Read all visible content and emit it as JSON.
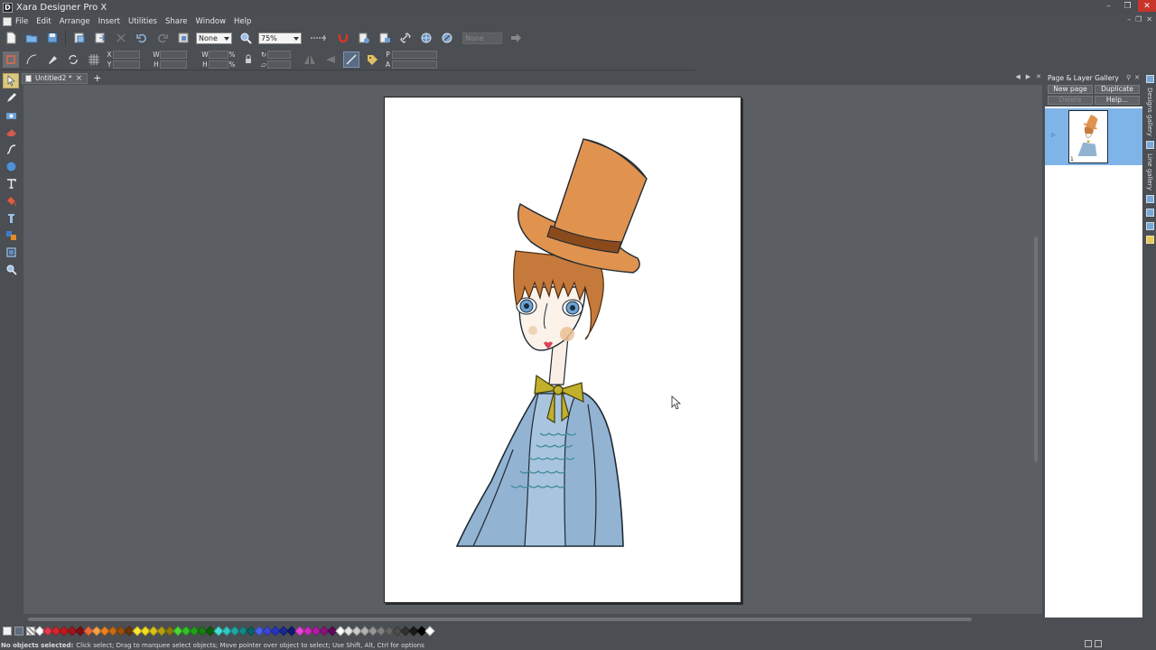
{
  "window": {
    "title": "Xara Designer Pro X",
    "app_icon_letter": "D",
    "controls": [
      "minimize",
      "maximize",
      "close"
    ]
  },
  "menu": {
    "items": [
      "File",
      "Edit",
      "Arrange",
      "Insert",
      "Utilities",
      "Share",
      "Window",
      "Help"
    ]
  },
  "toolbar1": {
    "quality_value": "None",
    "zoom_value": "75%",
    "disabled_combo_value": "None"
  },
  "toolbar2": {
    "labels": {
      "x": "X",
      "y": "Y",
      "w": "W",
      "h": "H",
      "w2": "W",
      "h2": "H",
      "p": "P",
      "a": "A",
      "pct1": "%",
      "pct2": "%"
    }
  },
  "document": {
    "tab_label": "Untitled2 *",
    "add_tab_symbol": "+"
  },
  "gallery": {
    "title": "Page & Layer Gallery",
    "buttons": [
      {
        "label": "New page",
        "enabled": true
      },
      {
        "label": "Duplicate",
        "enabled": true
      },
      {
        "label": "Delete",
        "enabled": false
      },
      {
        "label": "Help...",
        "enabled": true
      }
    ],
    "pages": [
      {
        "number": "1",
        "selected": true
      }
    ]
  },
  "side_tabs": [
    "Designs gallery",
    "Line gallery"
  ],
  "palette": {
    "colors": [
      "#ffffff",
      "#e4394e",
      "#d8262b",
      "#c2181c",
      "#a5141b",
      "#7d0f12",
      "#f06a3b",
      "#f7a24b",
      "#ea8222",
      "#c96b10",
      "#9c4f0d",
      "#6e3609",
      "#fbe83c",
      "#f5dd21",
      "#d9c11a",
      "#b6a112",
      "#8f7e0b",
      "#4bdb38",
      "#33c226",
      "#21a318",
      "#168212",
      "#0d5e0b",
      "#46e0d8",
      "#30c8c3",
      "#20a8a6",
      "#15888a",
      "#0c6266",
      "#4a62f0",
      "#3748d8",
      "#2536bd",
      "#1a2799",
      "#0f1970",
      "#e845d6",
      "#cf2bbf",
      "#b21ca2",
      "#8c127f",
      "#60095a",
      "#ffffff",
      "#e6e6e6",
      "#cccccc",
      "#b3b3b3",
      "#999999",
      "#808080",
      "#666666",
      "#4d4d4d",
      "#333333",
      "#1a1a1a",
      "#000000",
      "#ffffff"
    ]
  },
  "status": {
    "bold": "No objects selected:",
    "text": "Click select; Drag to marquee select objects; Move pointer over object to select; Use Shift, Alt, Ctrl for options"
  }
}
